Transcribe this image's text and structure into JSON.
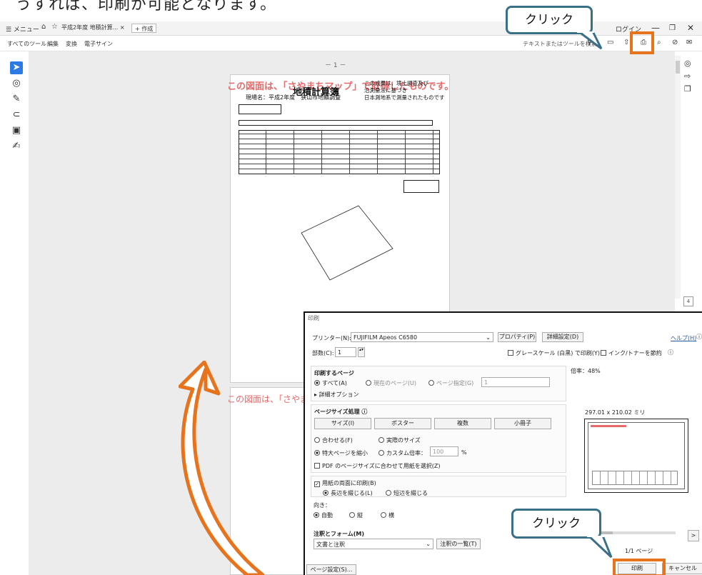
{
  "intro": {
    "text": "うすれば、印刷が可能となります。"
  },
  "titlebar": {
    "menu_label": "☰ メニュー",
    "tab_label": "平成2年度 地積計算...",
    "tab_close": "×",
    "new_tab_label": "+ 作成",
    "login_label": "ログイン",
    "minimize": "—",
    "maximize": "❐",
    "close": "✕"
  },
  "menubar": {
    "items": [
      "すべてのツール",
      "編集",
      "変換",
      "電子サイン"
    ],
    "search_placeholder": "テキストまたはツールを検索"
  },
  "document": {
    "page_number": "－ 1 －",
    "watermark_1": "この図面は、「さやまちマップ」で取得したものです。",
    "watermark_2": "この図面は、「さやま",
    "title": "地積計算簿",
    "site": "現場名：平成2年度　狭山市地籍調査",
    "note_1": "この成果は、境土調査及び",
    "note_2": "沿測量法に基づき",
    "note_3": "日本測地系で測量されたものです"
  },
  "callouts": {
    "top": "クリック",
    "bottom": "クリック"
  },
  "dialog": {
    "title": "印刷",
    "printer_label": "プリンター(N):",
    "printer_value": "FUJIFILM Apeos C6580",
    "properties": "プロパティ(P)",
    "advanced": "詳細設定(D)",
    "help": "ヘルプ(H)",
    "copies_label": "部数(C):",
    "copies_value": "1",
    "grayscale": "グレースケール (白黒) で印刷(Y)",
    "save_ink": "インク/トナーを節約",
    "pages_title": "印刷するページ",
    "all": "すべて(A)",
    "current": "現在のページ(U)",
    "pages_range": "ページ指定(G)",
    "pages_range_value": "1",
    "more_options": "▸ 詳細オプション",
    "size_title": "ページサイズ処理",
    "size_btn": "サイズ(I)",
    "poster_btn": "ポスター",
    "multiple_btn": "複数",
    "booklet_btn": "小冊子",
    "fit": "合わせる(F)",
    "actual": "実際のサイズ",
    "shrink": "特大ページを縮小",
    "custom": "カスタム倍率：",
    "custom_value": "100",
    "percent": "%",
    "pdf_paper": "PDF のページサイズに合わせて用紙を選択(Z)",
    "duplex": "用紙の両面に印刷(B)",
    "long_edge": "長辺を綴じる(L)",
    "short_edge": "短辺を綴じる",
    "orientation_label": "向き：",
    "auto": "自動",
    "portrait": "縦",
    "landscape": "横",
    "comments_title": "注釈とフォーム(M)",
    "comments_value": "文書と注釈",
    "comments_list": "注釈の一覧(T)",
    "scale": "倍率：48%",
    "paper_size": "297.01 x 210.02 ミリ",
    "page_count": "1/1 ページ",
    "page_setup": "ページ設定(S)...",
    "print": "印刷",
    "cancel": "キャンセル",
    "next": ">"
  },
  "colors": {
    "accent_orange": "#e8731d",
    "callout_border": "#3a6f88",
    "watermark": "#e86a6a",
    "select_blue": "#2c7be5"
  }
}
